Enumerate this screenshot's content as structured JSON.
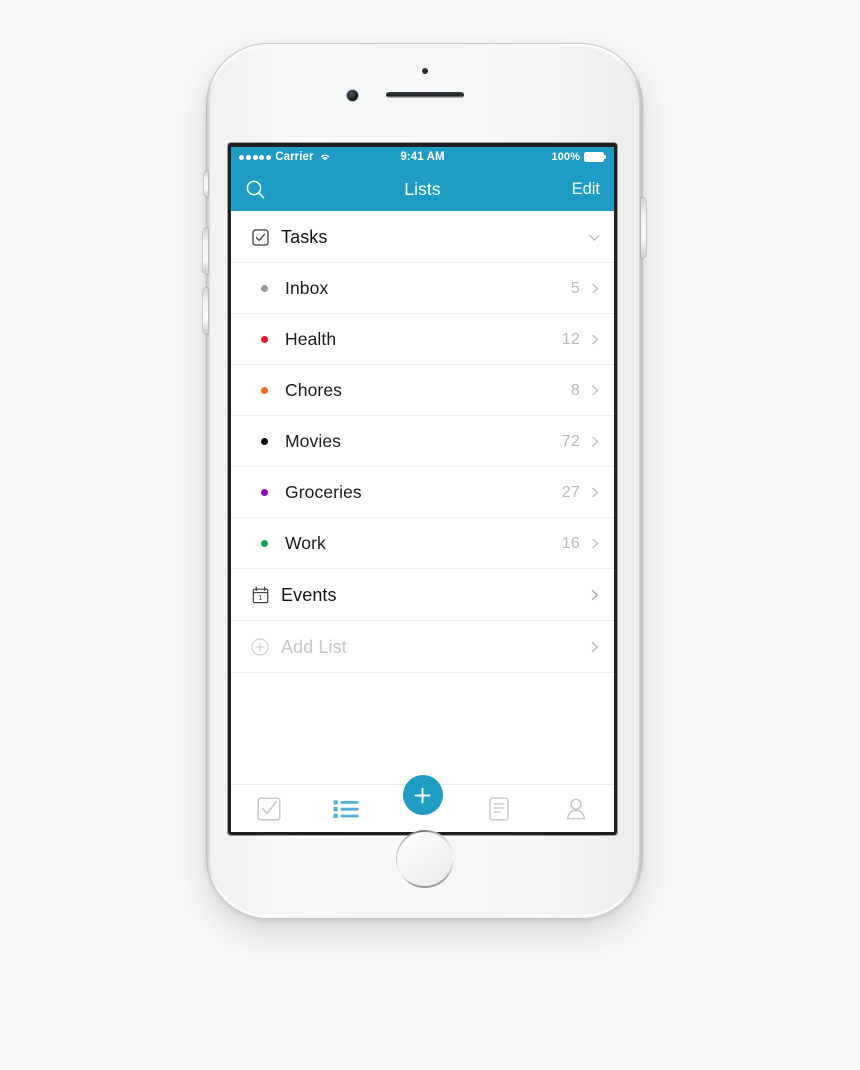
{
  "device": {
    "name": "iphone-6-white-silver"
  },
  "status_bar": {
    "signal_dots": 5,
    "carrier": "Carrier",
    "wifi_icon": "wifi-icon",
    "time": "9:41 AM",
    "battery_percent": "100%",
    "battery_icon": "battery-full-icon"
  },
  "nav_bar": {
    "search_icon": "search-icon",
    "title": "Lists",
    "edit_label": "Edit"
  },
  "colors": {
    "accent": "#1e9cc4",
    "divider": "#efefef",
    "count_text": "#b9b9b9",
    "muted_text": "#c7c7c7"
  },
  "list": {
    "groups": [
      {
        "label": "Tasks",
        "icon": "checkbox-check-icon",
        "accessory": "chevron-down-icon",
        "expanded": true,
        "items": [
          {
            "label": "Inbox",
            "count": "5",
            "dot_color": "#9b9b9b",
            "accessory": "chevron-right-icon"
          },
          {
            "label": "Health",
            "count": "12",
            "dot_color": "#e8152f",
            "accessory": "chevron-right-icon"
          },
          {
            "label": "Chores",
            "count": "8",
            "dot_color": "#f4681d",
            "accessory": "chevron-right-icon"
          },
          {
            "label": "Movies",
            "count": "72",
            "dot_color": "#000000",
            "accessory": "chevron-right-icon"
          },
          {
            "label": "Groceries",
            "count": "27",
            "dot_color": "#8c00b4",
            "accessory": "chevron-right-icon"
          },
          {
            "label": "Work",
            "count": "16",
            "dot_color": "#13a05a",
            "accessory": "chevron-right-icon"
          }
        ]
      }
    ],
    "events_row": {
      "label": "Events",
      "icon": "calendar-icon",
      "calendar_day": "1",
      "accessory": "chevron-right-icon"
    },
    "add_list_row": {
      "label": "Add List",
      "icon": "plus-circle-icon",
      "accessory": "chevron-right-icon",
      "muted": true
    }
  },
  "tab_bar": {
    "tabs": [
      {
        "name": "tasks",
        "icon": "checkbox-check-icon",
        "active": false
      },
      {
        "name": "lists",
        "icon": "list-bullets-icon",
        "active": true
      },
      {
        "name": "notes",
        "icon": "document-lines-icon",
        "active": false
      },
      {
        "name": "people",
        "icon": "person-icon",
        "active": false
      }
    ],
    "fab": {
      "name": "add-button",
      "icon": "plus-icon"
    }
  }
}
